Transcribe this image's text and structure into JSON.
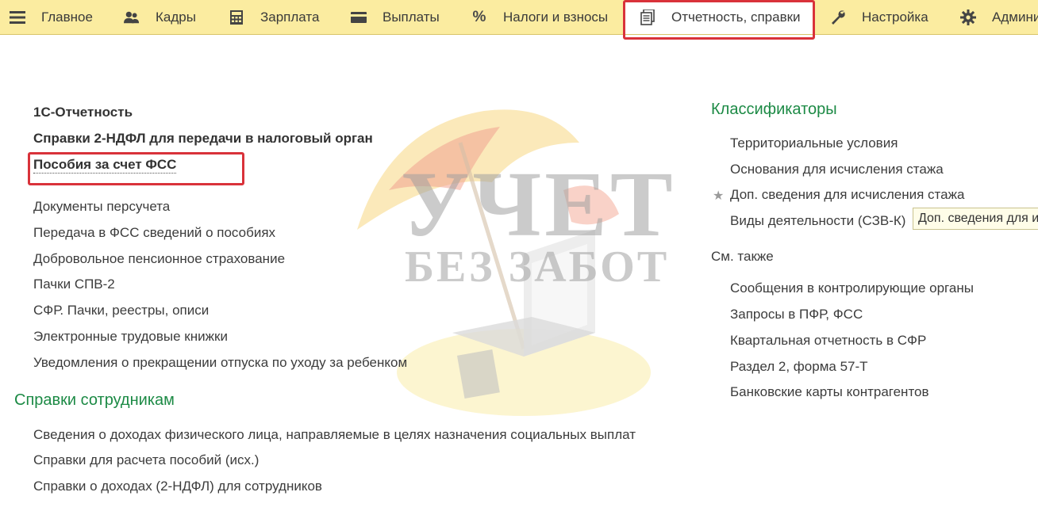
{
  "menu": {
    "items": [
      {
        "label": "Главное",
        "icon": "hamburger-icon"
      },
      {
        "label": "Кадры",
        "icon": "people-icon"
      },
      {
        "label": "Зарплата",
        "icon": "calculator-icon"
      },
      {
        "label": "Выплаты",
        "icon": "wallet-icon"
      },
      {
        "label": "Налоги и взносы",
        "icon": "percent-icon"
      },
      {
        "label": "Отчетность, справки",
        "icon": "documents-icon",
        "active": true
      },
      {
        "label": "Настройка",
        "icon": "wrench-icon"
      },
      {
        "label": "Админи",
        "icon": "gear-icon"
      }
    ],
    "percent_glyph": "%"
  },
  "left": {
    "links_bold": [
      "1С-Отчетность",
      "Справки 2-НДФЛ для передачи в налоговый орган",
      "Пособия за счет ФСС"
    ],
    "links": [
      "Документы персучета",
      "Передача в ФСС сведений о пособиях",
      "Добровольное пенсионное страхование",
      "Пачки СПВ-2",
      "СФР. Пачки, реестры, описи",
      "Электронные трудовые книжки",
      "Уведомления о прекращении отпуска по уходу за ребенком"
    ],
    "group_employees": {
      "title": "Справки сотрудникам",
      "links": [
        "Сведения о доходах физического лица, направляемые в целях назначения социальных выплат",
        "Справки для расчета пособий (исх.)",
        "Справки о доходах (2-НДФЛ) для сотрудников"
      ]
    }
  },
  "right": {
    "classifiers": {
      "title": "Классификаторы",
      "links": [
        "Территориальные условия",
        "Основания для исчисления стажа",
        "Доп. сведения для исчисления стажа",
        "Виды деятельности (СЗВ-К)"
      ]
    },
    "tooltip": "Доп. сведения для и",
    "see_also": {
      "title": "См. также",
      "links": [
        "Сообщения в контролирующие органы",
        "Запросы в ПФР, ФСС",
        "Квартальная отчетность в СФР",
        "Раздел 2, форма 57-Т",
        "Банковские карты контрагентов"
      ]
    },
    "star_glyph": "★"
  },
  "watermark": {
    "line1": "УЧЕТ",
    "line2": "БЕЗ ЗАБОТ"
  },
  "colors": {
    "menu_bg": "#fbeca0",
    "group_title": "#1c8a45",
    "highlight_frame": "#d9323a"
  }
}
